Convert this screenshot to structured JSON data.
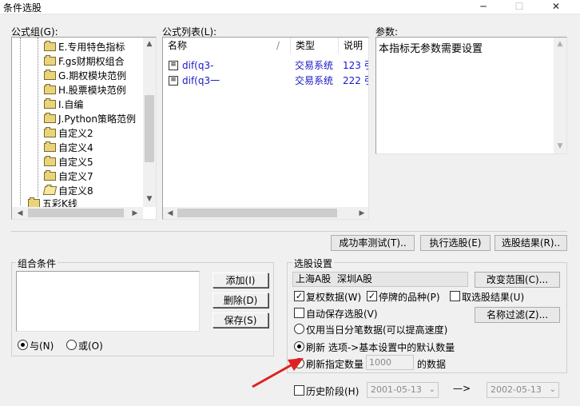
{
  "window": {
    "title": "条件选股",
    "minimize": "─",
    "maximize": "☐",
    "close": "✕"
  },
  "formula_group": {
    "label": "公式组(G):",
    "items": [
      {
        "label": "E.专用特色指标",
        "state": "closed"
      },
      {
        "label": "F.gs财期权组合",
        "state": "closed"
      },
      {
        "label": "G.期权模块范例",
        "state": "closed"
      },
      {
        "label": "H.股票模块范例",
        "state": "closed"
      },
      {
        "label": "I.自编",
        "state": "closed"
      },
      {
        "label": "J.Python策略范例",
        "state": "closed"
      },
      {
        "label": "自定义2",
        "state": "closed"
      },
      {
        "label": "自定义4",
        "state": "closed"
      },
      {
        "label": "自定义5",
        "state": "closed"
      },
      {
        "label": "自定义7",
        "state": "closed"
      },
      {
        "label": "自定义8",
        "state": "open"
      }
    ],
    "partial_item": "五彩K线"
  },
  "formula_list": {
    "label": "公式列表(L):",
    "columns": [
      "名称",
      "类型",
      "说明"
    ],
    "rows": [
      {
        "name": "dif(q3-",
        "type": "交易系统",
        "desc": "123 引"
      },
      {
        "name": "dif(q3一",
        "type": "交易系统",
        "desc": "222 引"
      }
    ]
  },
  "params": {
    "label": "参数:",
    "text": "本指标无参数需要设置"
  },
  "actions": {
    "success_rate": "成功率测试(T)..",
    "execute": "执行选股(E)",
    "result": "选股结果(R).."
  },
  "combo_conditions": {
    "title": "组合条件",
    "add": "添加(I)",
    "delete": "删除(D)",
    "save": "保存(S)",
    "and_label": "与(N)",
    "or_label": "或(O)"
  },
  "settings": {
    "title": "选股设置",
    "range": "上海A股  深圳A股",
    "change_range": "改变范围(C)...",
    "rights": "复权数据(W)",
    "suspended": "停牌的品种(P)",
    "take_result": "取选股结果(U)",
    "auto_save": "自动保存选股(V)",
    "name_filter": "名称过滤(Z)...",
    "only_today": "仅用当日分笔数据(可以提高速度)",
    "refresh_default": "刷新 选项->基本设置中的默认数量",
    "refresh_count_label": "刷新指定数量",
    "refresh_count_value": "1000",
    "refresh_count_suffix": "的数据",
    "history": "历史阶段(H)",
    "date_from": "2001-05-13",
    "date_to": "2002-05-13",
    "arrow": "—>"
  }
}
